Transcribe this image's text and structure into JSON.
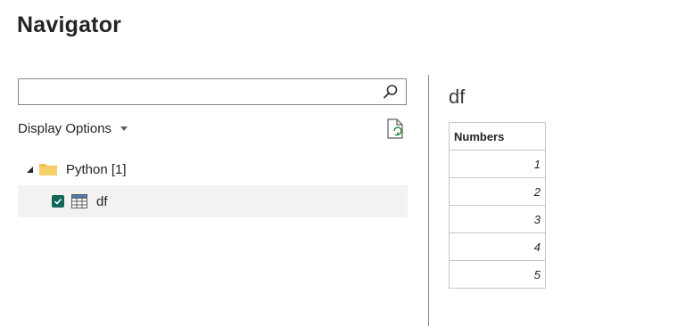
{
  "header": {
    "title": "Navigator"
  },
  "search": {
    "value": "",
    "icon": "search-icon"
  },
  "options": {
    "display_label": "Display Options",
    "refresh_icon": "refresh-document-icon"
  },
  "tree": {
    "folder": {
      "label": "Python [1]",
      "icon": "folder-icon",
      "expanded": true
    },
    "items": [
      {
        "label": "df",
        "checked": true,
        "icon": "table-icon",
        "selected": true
      }
    ]
  },
  "preview": {
    "title": "df",
    "columns": [
      "Numbers"
    ],
    "rows": [
      "1",
      "2",
      "3",
      "4",
      "5"
    ]
  },
  "colors": {
    "checkbox": "#11675a",
    "folder": "#f2c14e",
    "selected_row": "#f3f2f1",
    "border": "#8a8886"
  }
}
